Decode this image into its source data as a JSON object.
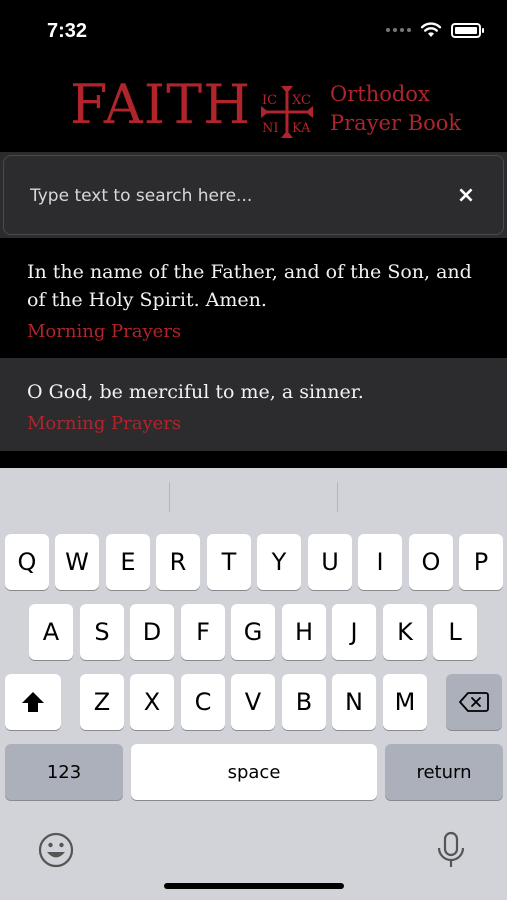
{
  "status_bar": {
    "time": "7:32"
  },
  "header": {
    "logo_word": "FAITH",
    "logo_sub_line1": "Orthodox",
    "logo_sub_line2": "Prayer Book",
    "cross_letters": [
      "IC",
      "XC",
      "NI",
      "KA"
    ]
  },
  "search": {
    "placeholder": "Type text to search here...",
    "value": "",
    "clear_label": "×"
  },
  "results": [
    {
      "text": "In the name of the Father, and of the Son, and of the Holy Spirit. Amen.",
      "source": "Morning Prayers"
    },
    {
      "text": "O God, be merciful to me, a sinner.",
      "source": "Morning Prayers"
    }
  ],
  "keyboard": {
    "row1": [
      "Q",
      "W",
      "E",
      "R",
      "T",
      "Y",
      "U",
      "I",
      "O",
      "P"
    ],
    "row2": [
      "A",
      "S",
      "D",
      "F",
      "G",
      "H",
      "J",
      "K",
      "L"
    ],
    "row3": [
      "Z",
      "X",
      "C",
      "V",
      "B",
      "N",
      "M"
    ],
    "numbers_label": "123",
    "space_label": "space",
    "return_label": "return"
  },
  "colors": {
    "accent": "#b0242c",
    "background": "#000000",
    "panel": "#2c2c2e",
    "keyboard": "#d1d3d9"
  },
  "icons": [
    "wifi-icon",
    "battery-icon",
    "cross-logo-icon",
    "close-icon",
    "shift-icon",
    "backspace-icon",
    "emoji-icon",
    "microphone-icon"
  ]
}
